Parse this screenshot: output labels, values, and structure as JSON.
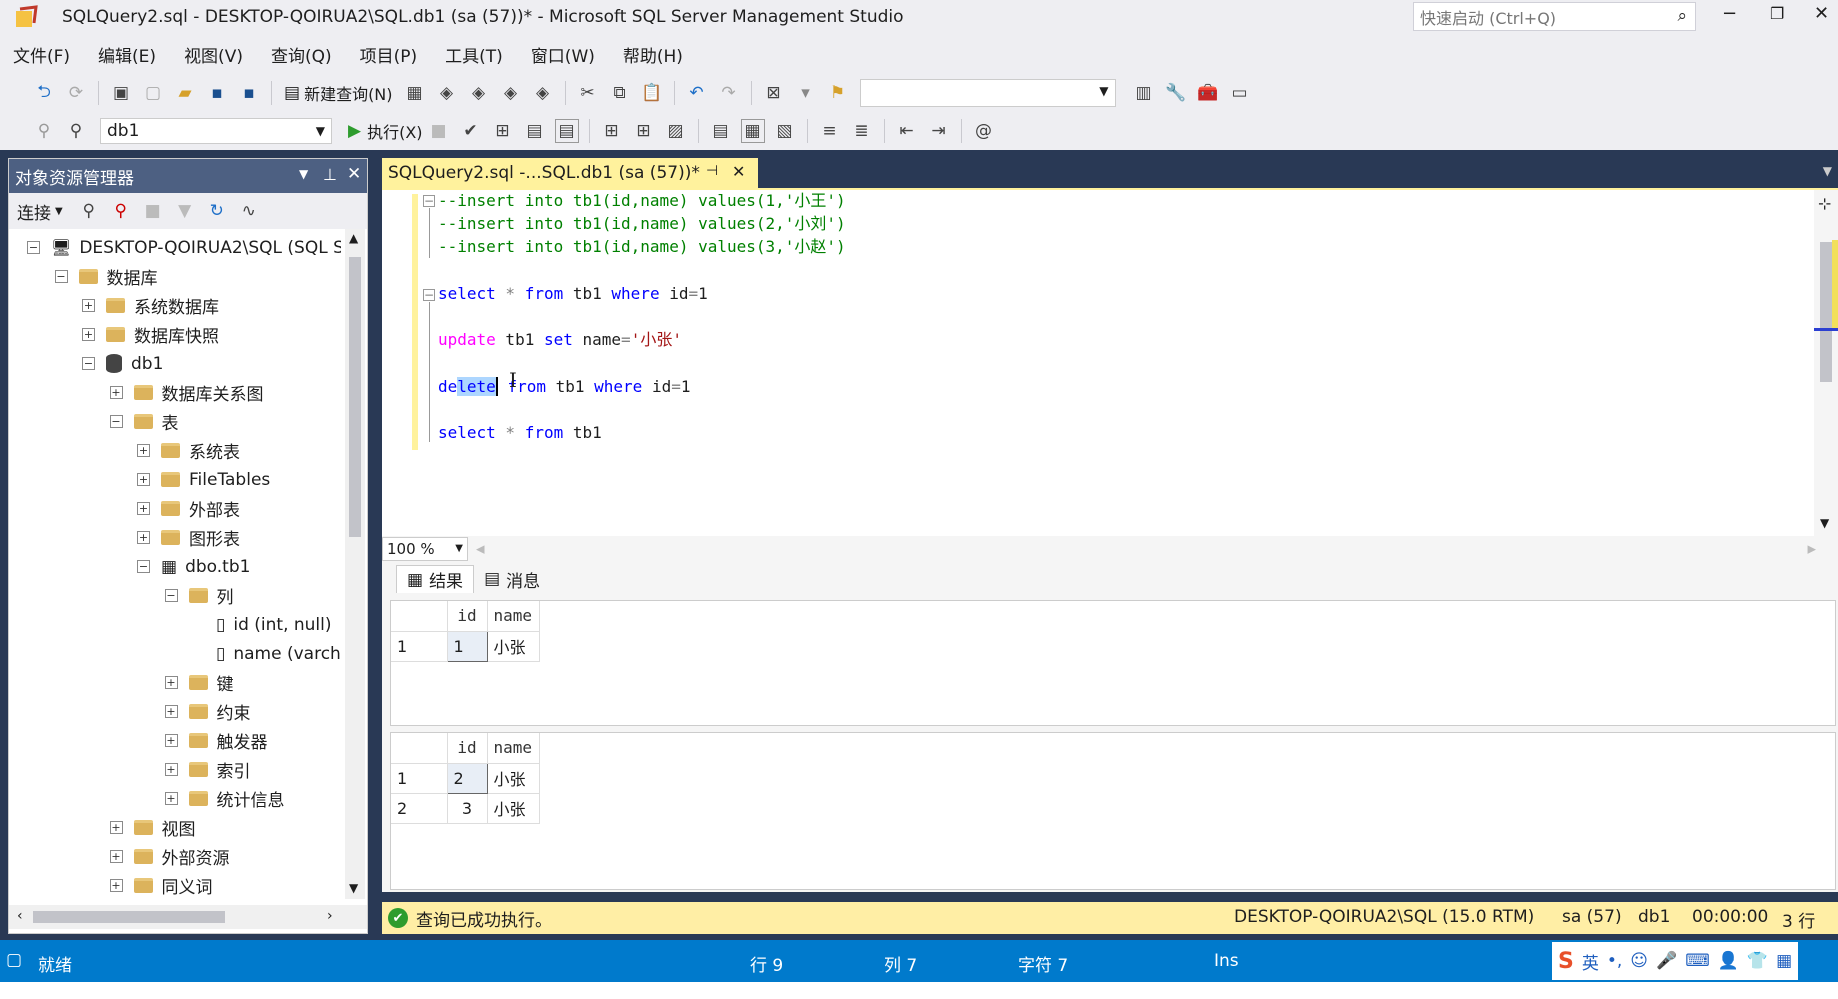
{
  "window": {
    "title": "SQLQuery2.sql - DESKTOP-QOIRUA2\\SQL.db1 (sa (57))* - Microsoft SQL Server Management Studio",
    "quick_launch": "快速启动 (Ctrl+Q)"
  },
  "menu": [
    "文件(F)",
    "编辑(E)",
    "视图(V)",
    "查询(Q)",
    "项目(P)",
    "工具(T)",
    "窗口(W)",
    "帮助(H)"
  ],
  "toolbar": {
    "new_query": "新建查询(N)",
    "database": "db1",
    "execute": "执行(X)"
  },
  "object_explorer": {
    "title": "对象资源管理器",
    "connect": "连接",
    "items": [
      {
        "label": "DESKTOP-QOIRUA2\\SQL (SQL S",
        "level": 0,
        "toggle": "−",
        "icon": "server"
      },
      {
        "label": "数据库",
        "level": 1,
        "toggle": "−",
        "icon": "folder"
      },
      {
        "label": "系统数据库",
        "level": 2,
        "toggle": "+",
        "icon": "folder"
      },
      {
        "label": "数据库快照",
        "level": 2,
        "toggle": "+",
        "icon": "folder"
      },
      {
        "label": "db1",
        "level": 2,
        "toggle": "−",
        "icon": "database"
      },
      {
        "label": "数据库关系图",
        "level": 3,
        "toggle": "+",
        "icon": "folder"
      },
      {
        "label": "表",
        "level": 3,
        "toggle": "−",
        "icon": "folder"
      },
      {
        "label": "系统表",
        "level": 4,
        "toggle": "+",
        "icon": "folder"
      },
      {
        "label": "FileTables",
        "level": 4,
        "toggle": "+",
        "icon": "folder"
      },
      {
        "label": "外部表",
        "level": 4,
        "toggle": "+",
        "icon": "folder"
      },
      {
        "label": "图形表",
        "level": 4,
        "toggle": "+",
        "icon": "folder"
      },
      {
        "label": "dbo.tb1",
        "level": 4,
        "toggle": "−",
        "icon": "table"
      },
      {
        "label": "列",
        "level": 5,
        "toggle": "−",
        "icon": "folder"
      },
      {
        "label": "id (int, null)",
        "level": 6,
        "toggle": "",
        "icon": "column"
      },
      {
        "label": "name (varcha",
        "level": 6,
        "toggle": "",
        "icon": "column"
      },
      {
        "label": "键",
        "level": 5,
        "toggle": "+",
        "icon": "folder"
      },
      {
        "label": "约束",
        "level": 5,
        "toggle": "+",
        "icon": "folder"
      },
      {
        "label": "触发器",
        "level": 5,
        "toggle": "+",
        "icon": "folder"
      },
      {
        "label": "索引",
        "level": 5,
        "toggle": "+",
        "icon": "folder"
      },
      {
        "label": "统计信息",
        "level": 5,
        "toggle": "+",
        "icon": "folder"
      },
      {
        "label": "视图",
        "level": 3,
        "toggle": "+",
        "icon": "folder"
      },
      {
        "label": "外部资源",
        "level": 3,
        "toggle": "+",
        "icon": "folder"
      },
      {
        "label": "同义词",
        "level": 3,
        "toggle": "+",
        "icon": "folder"
      }
    ]
  },
  "editor": {
    "tab_title": "SQLQuery2.sql -...SQL.db1 (sa (57))*",
    "zoom": "100 %",
    "lines": {
      "l1": "--insert into tb1(id,name) values(1,'小王')",
      "l2": "--insert into tb1(id,name) values(2,'小刘')",
      "l3": "--insert into tb1(id,name) values(3,'小赵')",
      "l4a": "select",
      "l4b": " * ",
      "l4c": "from",
      "l4d": " tb1 ",
      "l4e": "where",
      "l4f": " id",
      "l4g": "=",
      "l4h": "1",
      "l5a": "update",
      "l5b": " tb1 ",
      "l5c": "set",
      "l5d": " name",
      "l5e": "=",
      "l5f": "'小张'",
      "l6a": "de",
      "l6b": "lete",
      "l6c": " ",
      "l6d": "from",
      "l6e": " tb1 ",
      "l6f": "where",
      "l6g": " id",
      "l6h": "=",
      "l6i": "1",
      "l7a": "select",
      "l7b": " * ",
      "l7c": "from",
      "l7d": " tb1"
    }
  },
  "results": {
    "tabs": [
      "结果",
      "消息"
    ],
    "grid1": {
      "columns": [
        "id",
        "name"
      ],
      "rows": [
        [
          "1",
          "1",
          "小张"
        ]
      ]
    },
    "grid2": {
      "columns": [
        "id",
        "name"
      ],
      "rows": [
        [
          "1",
          "2",
          "小张"
        ],
        [
          "2",
          "3",
          "小张"
        ]
      ]
    }
  },
  "query_status": {
    "message": "查询已成功执行。",
    "server": "DESKTOP-QOIRUA2\\SQL (15.0 RTM)",
    "user": "sa (57)",
    "db": "db1",
    "time": "00:00:00",
    "rows": "3 行"
  },
  "statusbar": {
    "ready": "就绪",
    "line": "行 9",
    "col": "列 7",
    "char": "字符 7",
    "mode": "Ins",
    "ime": "英"
  },
  "colors": {
    "chrome": "#eeeef2",
    "dark": "#293955",
    "status_blue": "#007acc",
    "tab_yellow": "#fff29d",
    "query_status_yellow": "#ffeea5"
  }
}
